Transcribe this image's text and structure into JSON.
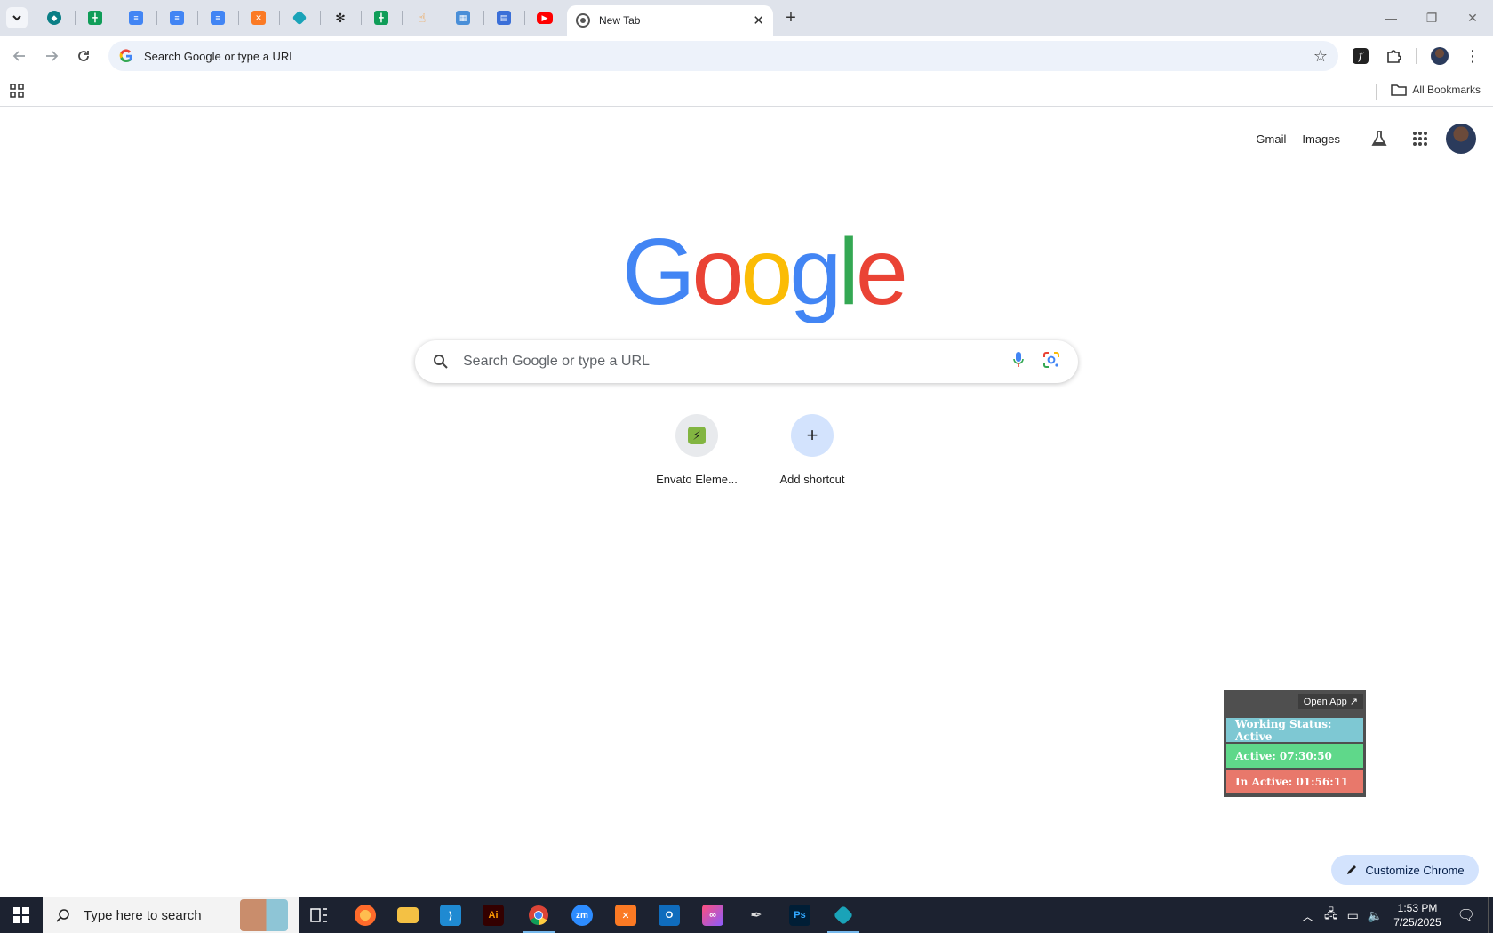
{
  "browser": {
    "active_tab": {
      "title": "New Tab"
    },
    "pinned_tabs": [
      {
        "icon": "vpn-shield-icon",
        "color": "#1a73e8"
      },
      {
        "icon": "sheets-icon",
        "color": "#0f9d58"
      },
      {
        "icon": "docs-icon",
        "color": "#4285f4"
      },
      {
        "icon": "docs-icon",
        "color": "#4285f4"
      },
      {
        "icon": "docs-icon",
        "color": "#4285f4"
      },
      {
        "icon": "xampp-icon",
        "color": "#fb7a24"
      },
      {
        "icon": "app-diamond-icon",
        "color": "#1aa3b8"
      },
      {
        "icon": "openai-icon",
        "color": "#222222"
      },
      {
        "icon": "sheets-icon",
        "color": "#0f9d58"
      },
      {
        "icon": "hand-icon",
        "color": "#f29a3a"
      },
      {
        "icon": "qr-icon",
        "color": "#4a8fd8"
      },
      {
        "icon": "forms-icon",
        "color": "#3b6fd8"
      },
      {
        "icon": "youtube-icon",
        "color": "#ff0000"
      }
    ],
    "omnibox_placeholder": "Search Google or type a URL",
    "bookmarks_label": "All Bookmarks"
  },
  "ntp": {
    "links": {
      "gmail": "Gmail",
      "images": "Images"
    },
    "logo": [
      "G",
      "o",
      "o",
      "g",
      "l",
      "e"
    ],
    "logo_colors": [
      "#4285f4",
      "#ea4335",
      "#fbbc05",
      "#4285f4",
      "#34a853",
      "#ea4335"
    ],
    "search_placeholder": "Search Google or type a URL",
    "shortcuts": [
      {
        "label": "Envato Eleme...",
        "icon": "envato-icon"
      },
      {
        "label": "Add shortcut",
        "icon": "plus-icon"
      }
    ],
    "customize_label": "Customize Chrome"
  },
  "widget": {
    "open_app": "Open App ↗",
    "status": "Working Status: Active",
    "active": "Active: 07:30:50",
    "inactive": "In Active: 01:56:11",
    "colors": {
      "status": "#7ec8d3",
      "active": "#5fd88a",
      "inactive": "#e8786b"
    }
  },
  "taskbar": {
    "search_placeholder": "Type here to search",
    "time": "1:53 PM",
    "date": "7/25/2025"
  }
}
